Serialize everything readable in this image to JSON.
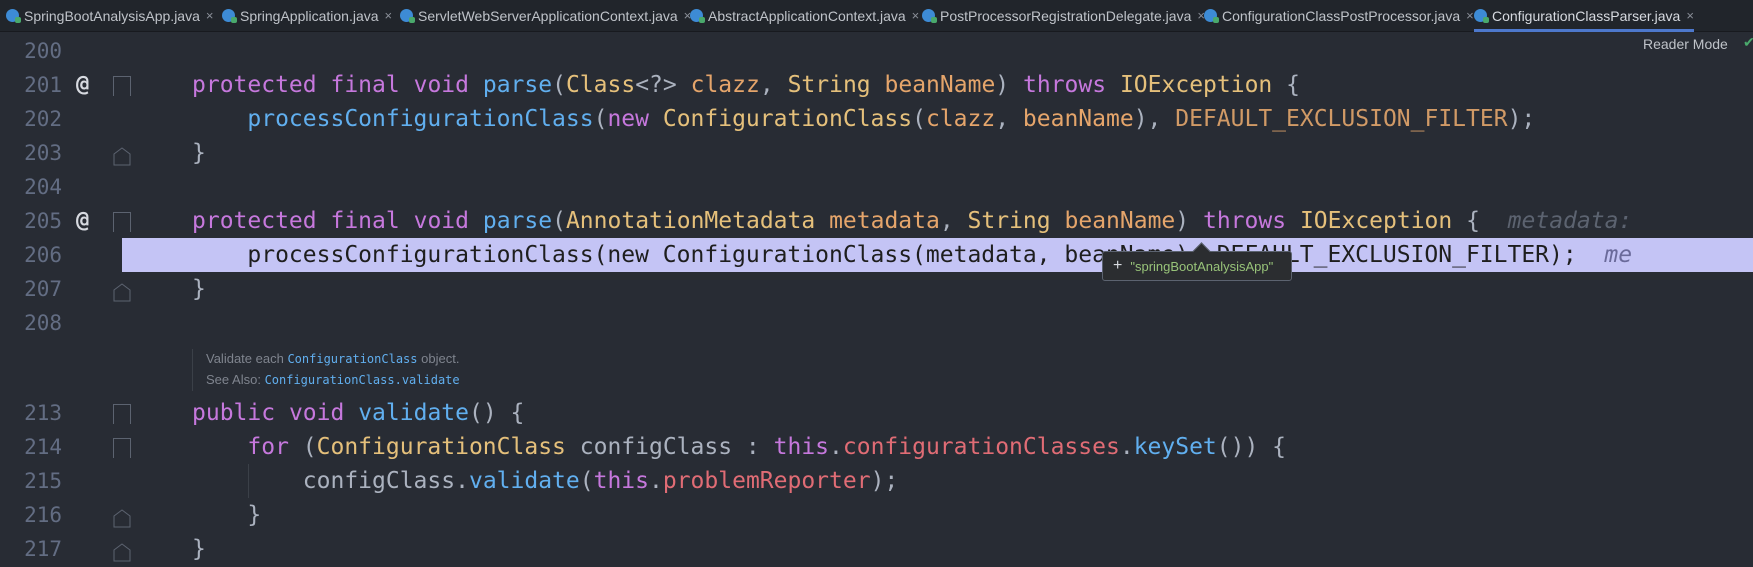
{
  "tabs": [
    {
      "label": "SpringBootAnalysisApp.java",
      "active": false
    },
    {
      "label": "SpringApplication.java",
      "active": false
    },
    {
      "label": "ServletWebServerApplicationContext.java",
      "active": false
    },
    {
      "label": "AbstractApplicationContext.java",
      "active": false
    },
    {
      "label": "PostProcessorRegistrationDelegate.java",
      "active": false
    },
    {
      "label": "ConfigurationClassPostProcessor.java",
      "active": false
    },
    {
      "label": "ConfigurationClassParser.java",
      "active": true
    }
  ],
  "close_symbol": "×",
  "reader_mode": "Reader Mode",
  "lines": {
    "l200": "200",
    "l201": "201",
    "l202": "202",
    "l203": "203",
    "l204": "204",
    "l205": "205",
    "l206": "206",
    "l207": "207",
    "l208": "208",
    "l213": "213",
    "l214": "214",
    "l215": "215",
    "l216": "216",
    "l217": "217"
  },
  "code": {
    "protected": "protected",
    "final": "final",
    "void": "void",
    "parse": "parse",
    "class_generic": "Class",
    "generic": "<?>",
    "clazz": "clazz",
    "string": "String",
    "beanName": "beanName",
    "throws": "throws",
    "ioexception": "IOException",
    "processConfigurationClass": "processConfigurationClass",
    "new": "new",
    "configurationClass": "ConfigurationClass",
    "default_filter": "DEFAULT_EXCLUSION_FILTER",
    "annotationMetadata": "AnnotationMetadata",
    "metadata": "metadata",
    "hint_metadata": "metadata:",
    "hint_me": "me",
    "line206": "processConfigurationClass(new ConfigurationClass(metadata, beanName), DEFAULT_EXCLUSION_FILTER);",
    "public": "public",
    "validate": "validate",
    "for": "for",
    "configClass": "configClass",
    "this": "this",
    "configurationClasses": "configurationClasses",
    "keySet": "keySet",
    "problemReporter": "problemReporter"
  },
  "doc": {
    "validate_each": "Validate each",
    "configuration_class": "ConfigurationClass",
    "object": "object.",
    "see_also": "See Also:",
    "see_link": "ConfigurationClass.validate"
  },
  "tooltip": {
    "plus": "+",
    "value": "\"springBootAnalysisApp\""
  },
  "colors": {
    "highlight": "#c4c4f5",
    "background": "#282c34",
    "keyword": "#c678dd",
    "function": "#61afef",
    "type": "#e5c07b",
    "field": "#e06c75"
  }
}
